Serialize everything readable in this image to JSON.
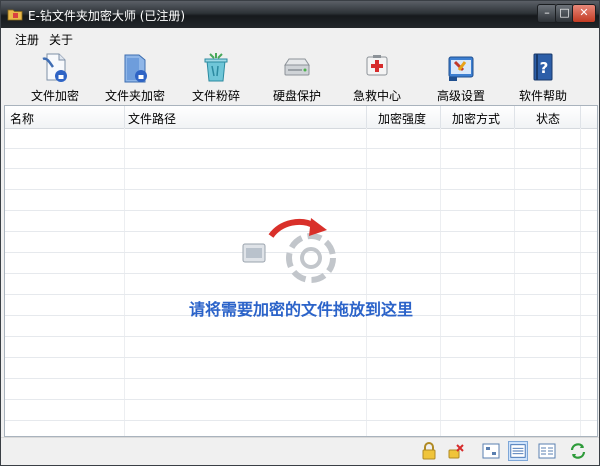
{
  "window": {
    "title": "E-钻文件夹加密大师 (已注册)",
    "controls": [
      "minimize-icon",
      "maximize-icon",
      "close-icon"
    ]
  },
  "menu": {
    "items": [
      "注册",
      "关于"
    ]
  },
  "toolbar": {
    "items": [
      {
        "label": "文件加密",
        "icon": "file-encrypt-icon"
      },
      {
        "label": "文件夹加密",
        "icon": "folder-encrypt-icon"
      },
      {
        "label": "文件粉碎",
        "icon": "file-shred-icon"
      },
      {
        "label": "硬盘保护",
        "icon": "disk-protect-icon"
      },
      {
        "label": "急救中心",
        "icon": "rescue-center-icon"
      },
      {
        "label": "高级设置",
        "icon": "advanced-settings-icon"
      },
      {
        "label": "软件帮助",
        "icon": "help-book-icon"
      }
    ]
  },
  "list": {
    "columns": [
      "名称",
      "文件路径",
      "加密强度",
      "加密方式",
      "状态"
    ],
    "rows": [],
    "drop_hint": "请将需要加密的文件拖放到这里"
  },
  "statusbar": {
    "buttons": [
      "lock-icon",
      "unlock-icon",
      "large-icons-view-icon",
      "details-view-icon",
      "list-view-icon",
      "refresh-icon"
    ],
    "active_index": 3
  },
  "colors": {
    "accent": "#2b63c9",
    "drop_arrow": "#d9302a"
  }
}
